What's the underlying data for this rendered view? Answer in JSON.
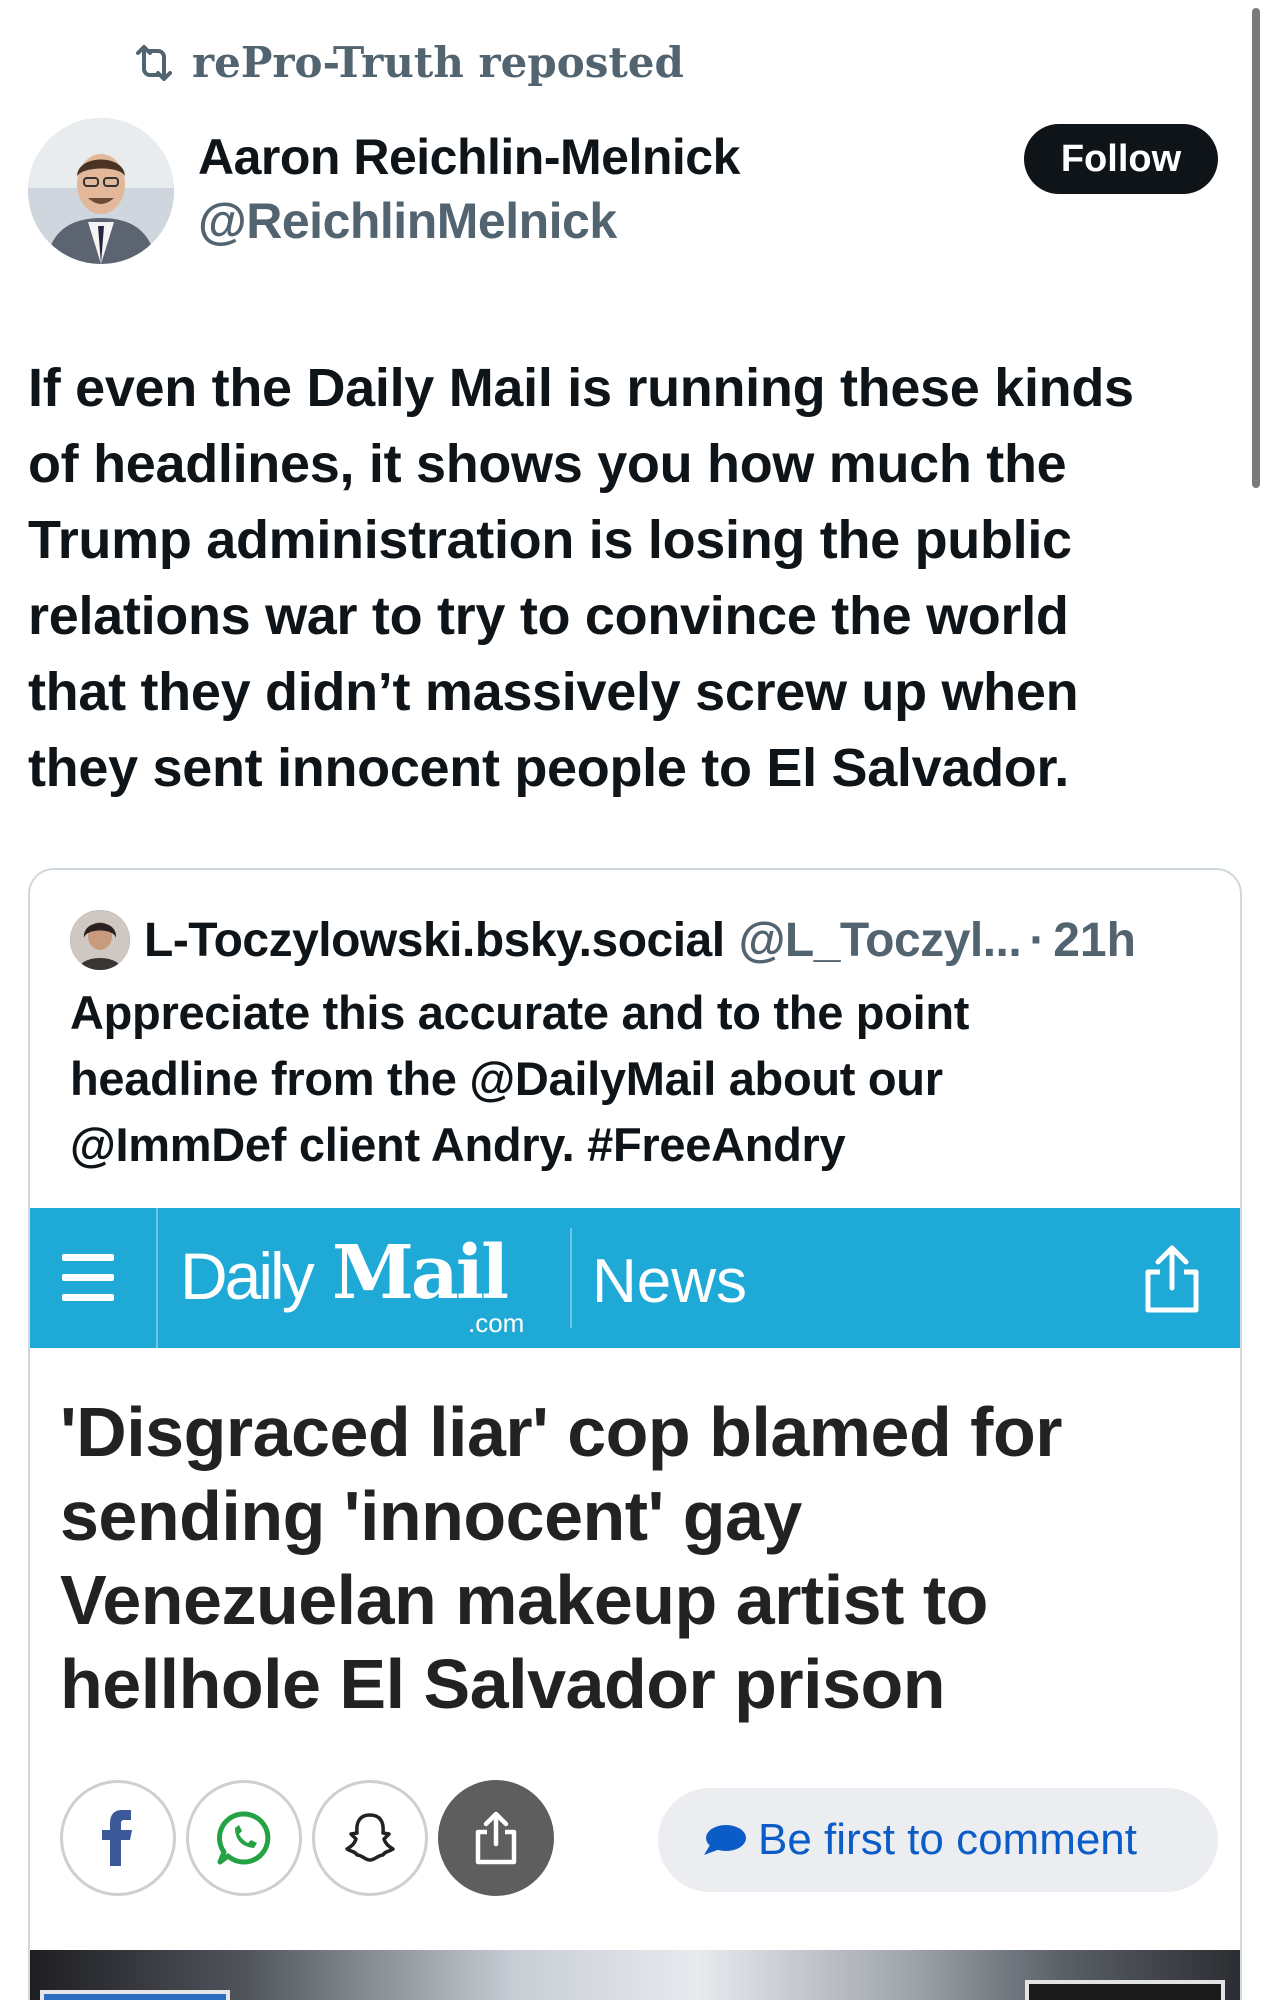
{
  "repost": {
    "text": "rePro-Truth reposted"
  },
  "author": {
    "name": "Aaron Reichlin-Melnick",
    "handle": "@ReichlinMelnick",
    "follow_label": "Follow"
  },
  "post": {
    "lines": [
      "If even the Daily Mail is running these kinds",
      "of headlines, it shows you how much the",
      "Trump administration is losing the public",
      "relations war to try to convince the world",
      "that they didn’t massively screw up when",
      "they sent innocent people to El Salvador."
    ]
  },
  "quote": {
    "name": "L-Toczylowski.bsky.social",
    "handle": "@L_Toczyl...",
    "separator": "·",
    "time": "21h",
    "lines": [
      "Appreciate this accurate and to the point",
      "headline from the @DailyMail about our",
      "@ImmDef client Andry. #FreeAndry"
    ]
  },
  "dailymail": {
    "logo_daily": "Daily",
    "logo_mail": "Mail",
    "logo_com": ".com",
    "section": "News",
    "headline_lines": [
      "'Disgraced liar' cop blamed for",
      "sending 'innocent' gay",
      "Venezuelan makeup artist to",
      "hellhole El Salvador prison"
    ],
    "share_icons": [
      "facebook-icon",
      "whatsapp-icon",
      "snapchat-icon",
      "share-icon"
    ],
    "comment_label": "Be first to comment",
    "colors": {
      "bar": "#1fa9d6",
      "comment_text": "#0c5cc7"
    }
  },
  "colors": {
    "text": "#0f1419",
    "secondary": "#536471",
    "follow_bg": "#0f1419"
  }
}
